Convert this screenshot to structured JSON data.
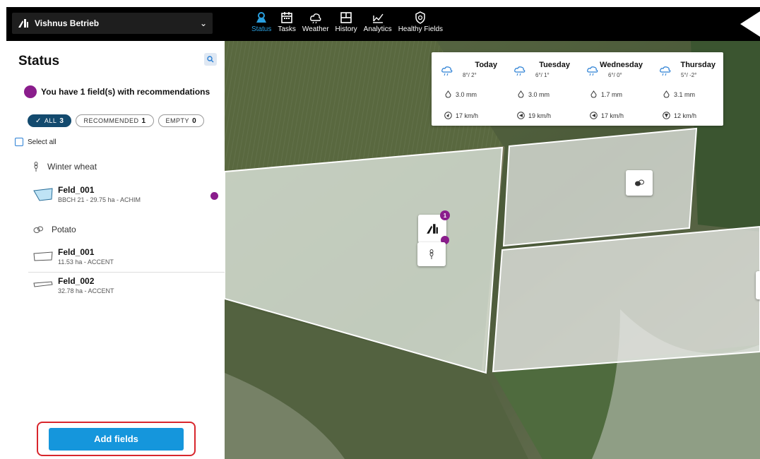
{
  "farm": {
    "name": "Vishnus Betrieb"
  },
  "nav": [
    {
      "label": "Status",
      "icon": "status-icon",
      "active": true
    },
    {
      "label": "Tasks",
      "icon": "calendar-icon"
    },
    {
      "label": "Weather",
      "icon": "weather-icon"
    },
    {
      "label": "History",
      "icon": "history-icon"
    },
    {
      "label": "Analytics",
      "icon": "analytics-icon"
    },
    {
      "label": "Healthy Fields",
      "icon": "shield-icon"
    }
  ],
  "sidebar": {
    "title": "Status",
    "recommendation_text": "You have 1 field(s) with recommendations",
    "filters": [
      {
        "label": "ALL",
        "count": "3",
        "active": true
      },
      {
        "label": "RECOMMENDED",
        "count": "1"
      },
      {
        "label": "EMPTY",
        "count": "0"
      }
    ],
    "select_all": "Select all",
    "groups": [
      {
        "crop": "Winter wheat",
        "fields": [
          {
            "name": "Feld_001",
            "details": "BBCH 21 - 29.75 ha - ACHIM",
            "has_recommendation": true
          }
        ]
      },
      {
        "crop": "Potato",
        "fields": [
          {
            "name": "Feld_001",
            "details": "11.53 ha - ACCENT"
          },
          {
            "name": "Feld_002",
            "details": "32.78 ha - ACCENT"
          }
        ]
      }
    ],
    "add_button": "Add fields"
  },
  "weather": [
    {
      "day": "Today",
      "temp": "8°/ 2°",
      "rain": "3.0 mm",
      "wind": "17 km/h"
    },
    {
      "day": "Tuesday",
      "temp": "6°/ 1°",
      "rain": "3.0 mm",
      "wind": "19 km/h"
    },
    {
      "day": "Wednesday",
      "temp": "6°/ 0°",
      "rain": "1.7 mm",
      "wind": "17 km/h"
    },
    {
      "day": "Thursday",
      "temp": "5°/ -2°",
      "rain": "3.1 mm",
      "wind": "12 km/h"
    }
  ],
  "map": {
    "recommendation_badge": "1"
  },
  "colors": {
    "accent": "#1596dc",
    "recommendation": "#8a1d8c",
    "chip_active": "#134a6e"
  }
}
